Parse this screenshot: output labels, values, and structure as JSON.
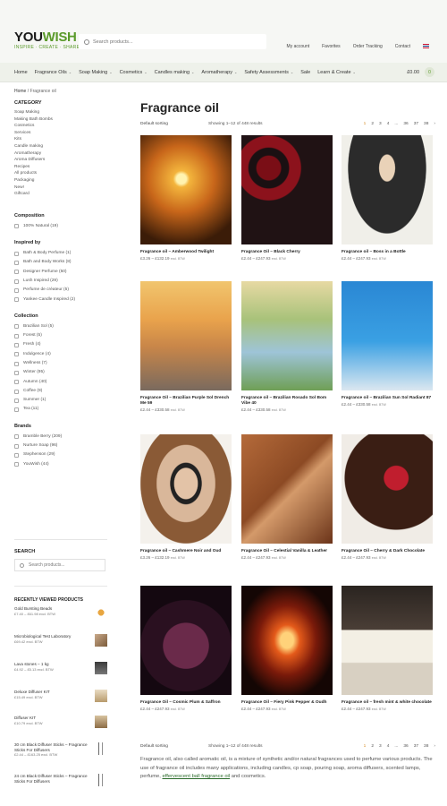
{
  "brand": {
    "name_part1": "YOU",
    "name_part2": "WISH",
    "tagline": "INSPIRE · CREATE · SHARE",
    "accent_color": "#5a9a2a"
  },
  "header": {
    "search_placeholder": "Search products...",
    "links": [
      "My account",
      "Favorites",
      "Order Tracking",
      "Contact"
    ]
  },
  "nav": {
    "items": [
      "Home",
      "Fragrance Oils",
      "Soap Making",
      "Cosmetics",
      "Candles making",
      "Aromatherapy",
      "Safety Assessments",
      "Sale",
      "Learn & Create"
    ],
    "has_dropdown": [
      false,
      true,
      true,
      true,
      true,
      true,
      true,
      false,
      true
    ],
    "cart_total": "£0.00",
    "cart_count": "0"
  },
  "breadcrumb": {
    "home": "Home",
    "sep": "/",
    "current": "Fragrance oil"
  },
  "sidebar": {
    "category_title": "CATEGORY",
    "categories": [
      "Soap Making",
      "Making Bath Bombs",
      "Cosmetics",
      "Services",
      "Kits",
      "Candle making",
      "Aromatherapy",
      "Aroma Diffusers",
      "Recipes",
      "All products",
      "Packaging",
      "New!",
      "Giftcard"
    ],
    "composition": {
      "title": "Composition",
      "items": [
        "100% Natural (19)"
      ]
    },
    "inspired": {
      "title": "Inspired by",
      "items": [
        "Bath & Body Perfume (1)",
        "Bath and Body Works (8)",
        "Designer Perfume (50)",
        "Lush Inspired (29)",
        "Perfume de créateur (5)",
        "Yankee Candle Inspired (2)"
      ]
    },
    "collection": {
      "title": "Collection",
      "items": [
        "Brazilian Sol (5)",
        "Forest (5)",
        "Fresh (4)",
        "Indulgence (4)",
        "Wellness (7)",
        "Winter (95)",
        "Autumn (40)",
        "Coffee (9)",
        "Summer (1)",
        "Tea (11)"
      ]
    },
    "brands": {
      "title": "Brands",
      "items": [
        "Bramble Berry (209)",
        "Nurture Soap (96)",
        "Stephenson (29)",
        "YouWish (44)"
      ]
    },
    "search_title": "SEARCH",
    "search_placeholder": "Search products...",
    "recent_title": "RECENTLY VIEWED PRODUCTS",
    "recent": [
      {
        "name": "Gold Bursting Beads",
        "price": "£7.40 – £61.98 excl. BTW"
      },
      {
        "name": "Microbiological Test Laboratory",
        "price": "£69.42 excl. BTW"
      },
      {
        "name": "Lava stones – 1 kg",
        "price": "£4.92 – £5.13 excl. BTW"
      },
      {
        "name": "Deluxe Diffuser KIT",
        "price": "£15.49 excl. BTW"
      },
      {
        "name": "Diffuser KIT",
        "price": "£10.79 excl. BTW"
      },
      {
        "name": "30 cm Black Diffuser Sticks – Fragrance Sticks For Diffusers",
        "price": "£2.44 – £163.25 excl. BTW"
      },
      {
        "name": "24 cm Black Diffuser Sticks – Fragrance Sticks For Diffusers",
        "price": ""
      }
    ]
  },
  "main": {
    "title": "Fragrance oil",
    "sort_label": "Default sorting",
    "result_count": "Showing 1–12 of 448 results",
    "pages": [
      "1",
      "2",
      "3",
      "4",
      "...",
      "36",
      "37",
      "38",
      "›"
    ],
    "current_page": "1",
    "products": [
      {
        "name": "Fragrance oil – Amberwood Twilight",
        "price": "£3.26 – £132.19",
        "vat": "excl. BTW"
      },
      {
        "name": "Fragrance Oil – Black Cherry",
        "price": "£2.44 – £247.93",
        "vat": "excl. BTW"
      },
      {
        "name": "Fragrance oil – Boss in a Bottle",
        "price": "£2.44 – £247.93",
        "vat": "excl. BTW"
      },
      {
        "name": "Fragrance Oil – Brazilian Purple Sol Drench Me 59",
        "price": "£2.44 – £330.58",
        "vat": "excl. BTW"
      },
      {
        "name": "Fragrance oil – Brazilian Rosado Sol Bom Vibe 40",
        "price": "£2.44 – £330.58",
        "vat": "excl. BTW"
      },
      {
        "name": "Fragrance oil – Brazilian Sun Sol Radiant 87",
        "price": "£2.44 – £330.58",
        "vat": "excl. BTW"
      },
      {
        "name": "Fragrance oil – Cashmere Noir and Oud",
        "price": "£3.26 – £132.19",
        "vat": "excl. BTW"
      },
      {
        "name": "Fragrance Oil – Celestial Vanilla & Leather",
        "price": "£2.44 – £247.93",
        "vat": "excl. BTW"
      },
      {
        "name": "Fragrance Oil – Cherry & Dark Chocolate",
        "price": "£2.44 – £247.93",
        "vat": "excl. BTW"
      },
      {
        "name": "Fragrance Oil – Cosmic Plum & Saffron",
        "price": "£2.44 – £247.93",
        "vat": "excl. BTW"
      },
      {
        "name": "Fragrance Oil – Fiery Pink Pepper & Oudh",
        "price": "£2.44 – £247.93",
        "vat": "excl. BTW"
      },
      {
        "name": "Fragrance oil – fresh mint & white chocolate",
        "price": "£2.44 – £247.93",
        "vat": "excl. BTW"
      }
    ],
    "description_before": "Fragrance oil, also called aromatic oil, is a mixture of synthetic and/or natural fragrances used to perfume various products. The use of fragrance oil includes many applications, including candles, cp soap, pouring soap, aroma diffusers, scented lamps, perfume, ",
    "description_link": "effervescent ball fragrance oil",
    "description_after": " and cosmetics."
  }
}
